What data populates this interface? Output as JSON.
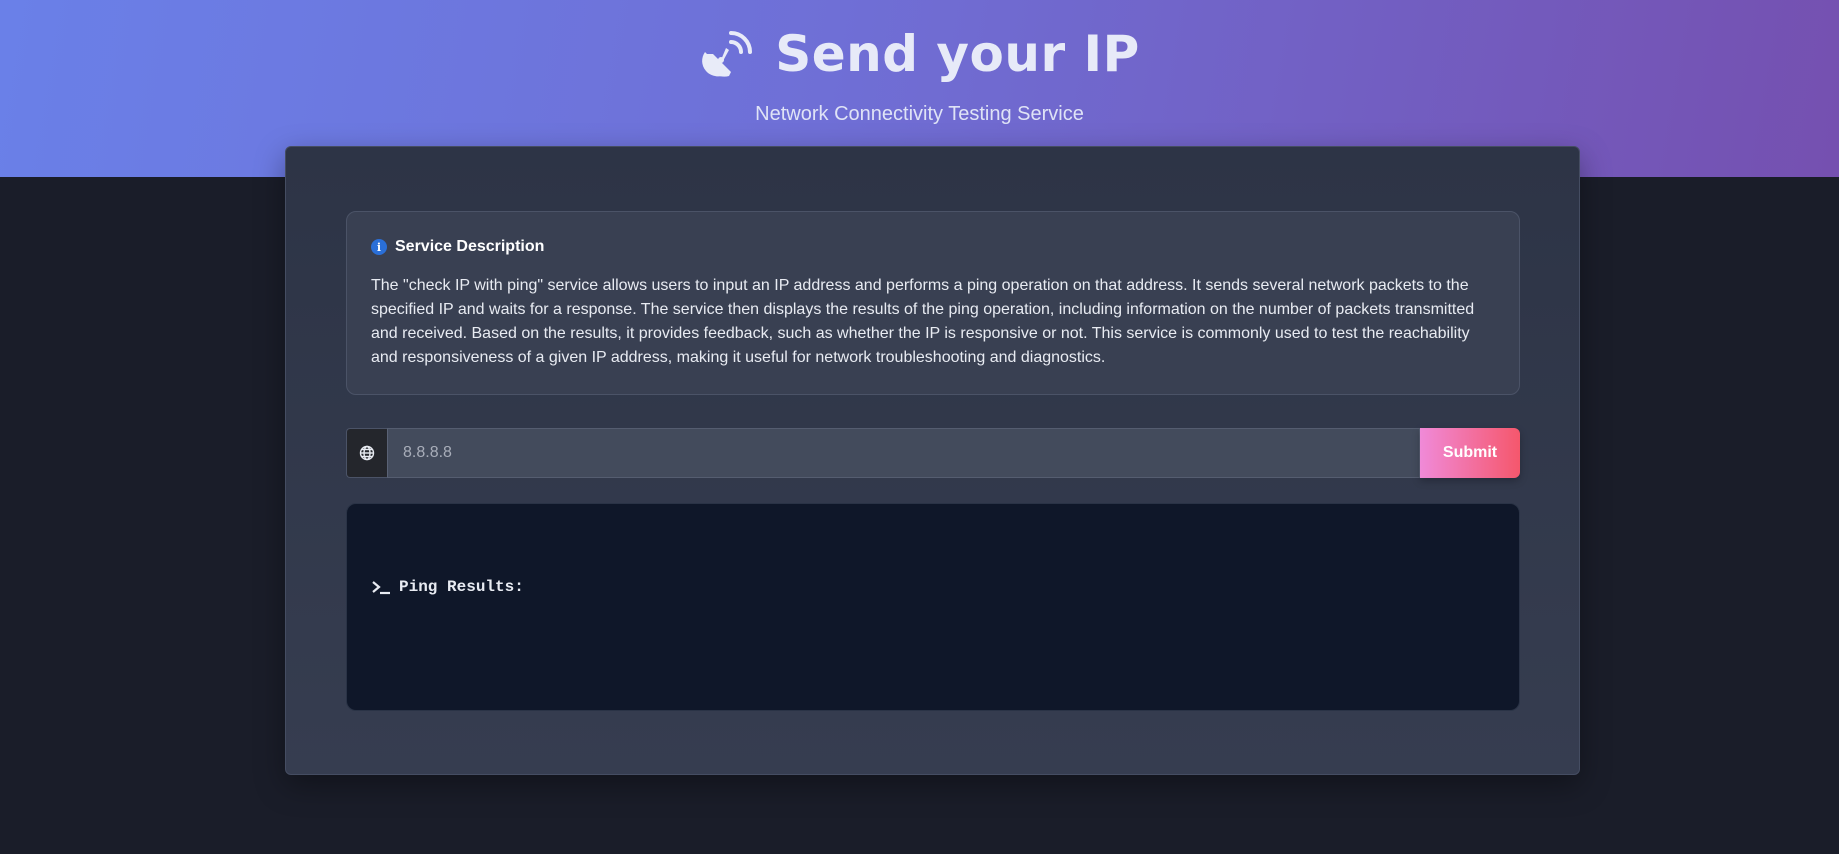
{
  "header": {
    "title": "Send your IP",
    "subtitle": "Network Connectivity Testing Service",
    "icon": "satellite-dish-icon"
  },
  "description": {
    "icon": "info-icon",
    "title": "Service Description",
    "text": "The \"check IP with ping\" service allows users to input an IP address and performs a ping operation on that address. It sends several network packets to the specified IP and waits for a response. The service then displays the results of the ping operation, including information on the number of packets transmitted and received. Based on the results, it provides feedback, such as whether the IP is responsive or not. This service is commonly used to test the reachability and responsiveness of a given IP address, making it useful for network troubleshooting and diagnostics."
  },
  "form": {
    "icon": "globe-icon",
    "value": "",
    "placeholder": "8.8.8.8",
    "submit_label": "Submit"
  },
  "results": {
    "icon": "terminal-icon",
    "label": "Ping Results:"
  },
  "colors": {
    "hero_start": "#6a80e8",
    "hero_end": "#7550b0",
    "button_start": "#f08ad8",
    "button_end": "#f5576c",
    "background": "#1a1d29"
  }
}
